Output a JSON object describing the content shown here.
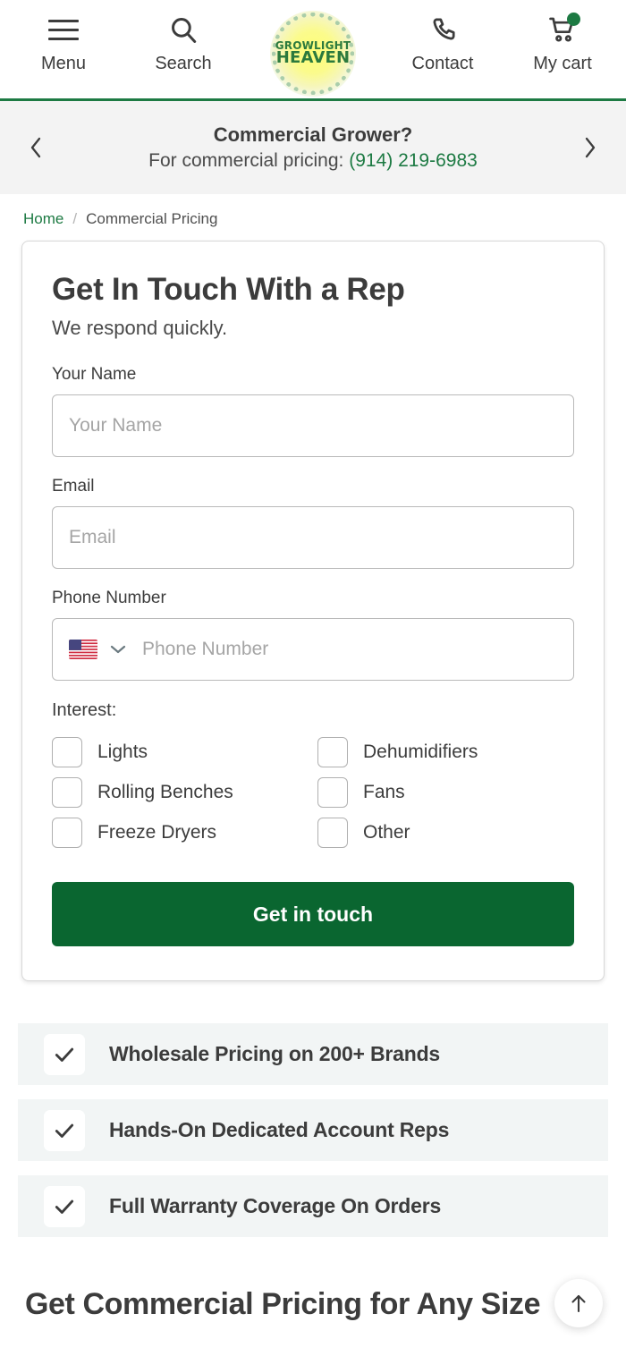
{
  "header": {
    "nav": [
      {
        "label": "Menu",
        "icon": "hamburger-menu-icon"
      },
      {
        "label": "Search",
        "icon": "search-icon"
      },
      {
        "label": "Contact",
        "icon": "phone-icon"
      },
      {
        "label": "My cart",
        "icon": "shopping-cart-icon"
      }
    ],
    "logo": {
      "line1": "GROWLIGHT",
      "line2": "HEAVEN"
    },
    "accent_green": "#1d7a43",
    "cart_badge_color": "#1d7a43"
  },
  "promo": {
    "prev_icon": "chevron-left-icon",
    "next_icon": "chevron-right-icon",
    "title": "Commercial Grower?",
    "subtitle_prefix": "For commercial pricing: ",
    "phone": "(914) 219-6983",
    "phone_color": "#1d7a43"
  },
  "breadcrumb": {
    "home": "Home",
    "separator": "/",
    "current": "Commercial Pricing"
  },
  "form": {
    "title": "Get In Touch With a Rep",
    "subtitle": "We respond quickly.",
    "fields": [
      {
        "label": "Your Name",
        "placeholder": "Your Name",
        "value": ""
      },
      {
        "label": "Email",
        "placeholder": "Email",
        "value": ""
      }
    ],
    "phone_field": {
      "label": "Phone Number",
      "placeholder": "Phone Number",
      "value": "",
      "country_flag": "us-flag-icon",
      "dropdown_icon": "chevron-down-icon"
    },
    "interest_label": "Interest:",
    "interests": [
      {
        "label": "Lights",
        "checked": false
      },
      {
        "label": "Dehumidifiers",
        "checked": false
      },
      {
        "label": "Rolling Benches",
        "checked": false
      },
      {
        "label": "Fans",
        "checked": false
      },
      {
        "label": "Freeze Dryers",
        "checked": false
      },
      {
        "label": "Other",
        "checked": false
      }
    ],
    "submit_label": "Get in touch",
    "submit_color": "#0a6630"
  },
  "benefits": [
    {
      "icon": "check-icon",
      "text": "Wholesale Pricing on 200+ Brands"
    },
    {
      "icon": "check-icon",
      "text": "Hands-On Dedicated Account Reps"
    },
    {
      "icon": "check-icon",
      "text": "Full Warranty Coverage On Orders"
    }
  ],
  "bottom_section": {
    "heading": "Get Commercial Pricing for Any Size"
  },
  "scroll_top": {
    "icon": "arrow-up-icon"
  }
}
